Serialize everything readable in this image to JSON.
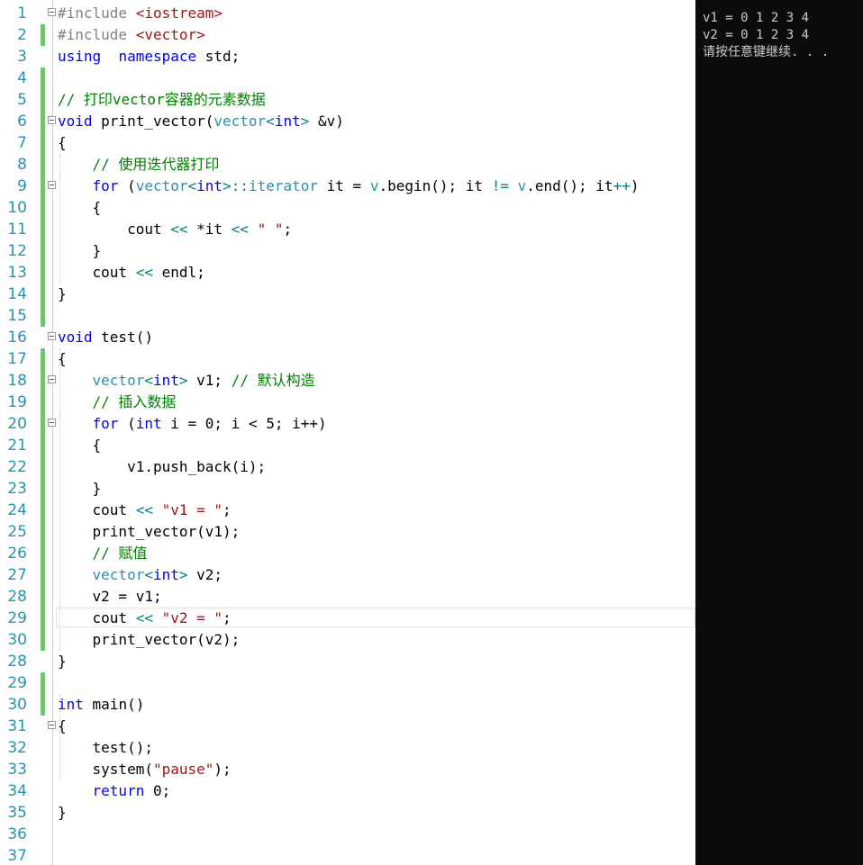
{
  "editor": {
    "line_numbers": [
      "1",
      "2",
      "3",
      "4",
      "5",
      "6",
      "7",
      "8",
      "9",
      "10",
      "11",
      "12",
      "13",
      "14",
      "15",
      "16",
      "17",
      "18",
      "19",
      "20",
      "21",
      "22",
      "23",
      "24",
      "25",
      "26",
      "27",
      "28",
      "29",
      "30",
      "28",
      "29",
      "30",
      "31",
      "32",
      "33",
      "34",
      "35",
      "36",
      "37"
    ],
    "lines": [
      [
        [
          "pp",
          "#include "
        ],
        [
          "st",
          "<iostream>"
        ]
      ],
      [
        [
          "pp",
          "#include "
        ],
        [
          "st",
          "<vector>"
        ]
      ],
      [
        [
          "kw",
          "using"
        ],
        [
          "",
          "  "
        ],
        [
          "kw",
          "namespace"
        ],
        [
          "",
          " std;"
        ]
      ],
      [],
      [
        [
          "cm",
          "// 打印vector容器的元素数据"
        ]
      ],
      [
        [
          "kw",
          "void"
        ],
        [
          "",
          " print_vector("
        ],
        [
          "ty",
          "vector"
        ],
        [
          "op",
          "<"
        ],
        [
          "kw",
          "int"
        ],
        [
          "op",
          ">"
        ],
        [
          "",
          " &v)"
        ]
      ],
      [
        [
          "",
          "{"
        ]
      ],
      [
        [
          "",
          "    "
        ],
        [
          "cm",
          "// 使用迭代器打印"
        ]
      ],
      [
        [
          "",
          "    "
        ],
        [
          "kw",
          "for"
        ],
        [
          "",
          " ("
        ],
        [
          "ty",
          "vector"
        ],
        [
          "op",
          "<"
        ],
        [
          "kw",
          "int"
        ],
        [
          "op",
          ">"
        ],
        [
          "op",
          "::"
        ],
        [
          "ty",
          "iterator"
        ],
        [
          "",
          " it = "
        ],
        [
          "ty",
          "v"
        ],
        [
          "",
          ".begin(); it "
        ],
        [
          "op",
          "!="
        ],
        [
          "",
          " "
        ],
        [
          "ty",
          "v"
        ],
        [
          "",
          ".end(); it"
        ],
        [
          "op",
          "++"
        ],
        [
          "",
          ")"
        ]
      ],
      [
        [
          "",
          "    {"
        ]
      ],
      [
        [
          "",
          "        cout "
        ],
        [
          "op",
          "<<"
        ],
        [
          "",
          " *it "
        ],
        [
          "op",
          "<<"
        ],
        [
          "",
          " "
        ],
        [
          "st",
          "\" \""
        ],
        [
          "",
          ";"
        ]
      ],
      [
        [
          "",
          "    }"
        ]
      ],
      [
        [
          "",
          "    cout "
        ],
        [
          "op",
          "<<"
        ],
        [
          "",
          " endl;"
        ]
      ],
      [
        [
          "",
          "}"
        ]
      ],
      [],
      [
        [
          "kw",
          "void"
        ],
        [
          "",
          " test()"
        ]
      ],
      [
        [
          "",
          "{"
        ]
      ],
      [
        [
          "",
          "    "
        ],
        [
          "ty",
          "vector"
        ],
        [
          "op",
          "<"
        ],
        [
          "kw",
          "int"
        ],
        [
          "op",
          ">"
        ],
        [
          "",
          " v1; "
        ],
        [
          "cm",
          "// 默认构造"
        ]
      ],
      [
        [
          "",
          "    "
        ],
        [
          "cm",
          "// 插入数据"
        ]
      ],
      [
        [
          "",
          "    "
        ],
        [
          "kw",
          "for"
        ],
        [
          "",
          " ("
        ],
        [
          "kw",
          "int"
        ],
        [
          "",
          " i = 0; i < 5; i++)"
        ]
      ],
      [
        [
          "",
          "    {"
        ]
      ],
      [
        [
          "",
          "        v1.push_back(i);"
        ]
      ],
      [
        [
          "",
          "    }"
        ]
      ],
      [
        [
          "",
          "    cout "
        ],
        [
          "op",
          "<<"
        ],
        [
          "",
          " "
        ],
        [
          "st",
          "\"v1 = \""
        ],
        [
          "",
          ";"
        ]
      ],
      [
        [
          "",
          "    print_vector(v1);"
        ]
      ],
      [
        [
          "",
          "    "
        ],
        [
          "cm",
          "// 赋值"
        ]
      ],
      [
        [
          "",
          "    "
        ],
        [
          "ty",
          "vector"
        ],
        [
          "op",
          "<"
        ],
        [
          "kw",
          "int"
        ],
        [
          "op",
          ">"
        ],
        [
          "",
          " v2;"
        ]
      ],
      [
        [
          "",
          "    v2 = v1;"
        ]
      ],
      [
        [
          "",
          "    cout "
        ],
        [
          "op",
          "<<"
        ],
        [
          "",
          " "
        ],
        [
          "st",
          "\"v2 = \""
        ],
        [
          "",
          ";"
        ]
      ],
      [
        [
          "",
          "    print_vector(v2);"
        ]
      ],
      [
        [
          "",
          "}"
        ]
      ],
      [],
      [
        [
          "kw",
          "int"
        ],
        [
          "",
          " main()"
        ]
      ],
      [
        [
          "",
          "{"
        ]
      ],
      [
        [
          "",
          "    test();"
        ]
      ],
      [
        [
          "",
          "    system("
        ],
        [
          "st",
          "\"pause\""
        ],
        [
          "",
          ");"
        ]
      ],
      [
        [
          "",
          "    "
        ],
        [
          "kw",
          "return"
        ],
        [
          "",
          " 0;"
        ]
      ],
      [
        [
          "",
          "}"
        ]
      ],
      [],
      []
    ]
  },
  "console": {
    "lines": [
      "v1 = 0 1 2 3 4",
      "v2 = 0 1 2 3 4",
      "请按任意键继续. . ."
    ]
  },
  "colors": {
    "keyword": "#0000ff",
    "type": "#2b91af",
    "comment": "#008000",
    "string": "#a31515",
    "preprocessor": "#808080",
    "line_number": "#2b91af",
    "change_bar": "#5fcf5f",
    "console_bg": "#0c0c0c"
  }
}
